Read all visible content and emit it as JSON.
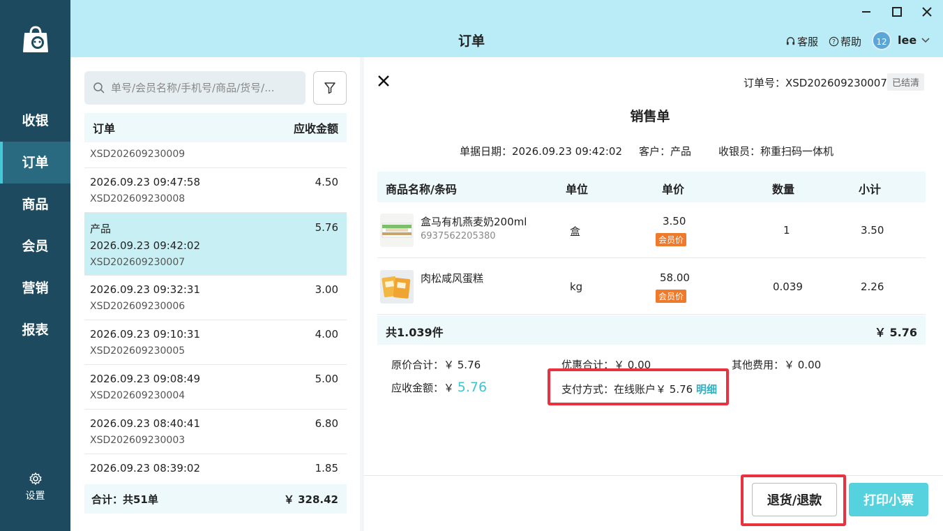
{
  "colors": {
    "nav_bg": "#1d4a5e",
    "nav_active": "#2a6a80",
    "topbar_bg": "#b9ecf6",
    "accent": "#56d2de",
    "member_tag": "#f07a2c",
    "highlight": "#e8333e"
  },
  "nav": {
    "items": [
      {
        "label": "收银",
        "icon": "cashier"
      },
      {
        "label": "订单",
        "icon": "orders",
        "active": true
      },
      {
        "label": "商品",
        "icon": "products"
      },
      {
        "label": "会员",
        "icon": "members"
      },
      {
        "label": "营销",
        "icon": "marketing"
      },
      {
        "label": "报表",
        "icon": "reports"
      }
    ],
    "settings_label": "设置"
  },
  "header": {
    "title": "订单",
    "support_label": "客服",
    "help_label": "帮助",
    "avatar_text": "12",
    "username": "lee"
  },
  "order_list": {
    "search_placeholder": "单号/会员名称/手机号/商品/货号/...",
    "col_order": "订单",
    "col_amount": "应收金额",
    "rows": [
      {
        "datetime": "",
        "order_no": "XSD202609230009",
        "amount": "",
        "partial": true
      },
      {
        "datetime": "2026.09.23 09:47:58",
        "order_no": "XSD202609230008",
        "amount": "4.50"
      },
      {
        "customer": "产品",
        "datetime": "2026.09.23 09:42:02",
        "order_no": "XSD202609230007",
        "amount": "5.76",
        "selected": true
      },
      {
        "datetime": "2026.09.23 09:32:31",
        "order_no": "XSD202609230006",
        "amount": "3.00"
      },
      {
        "datetime": "2026.09.23 09:10:31",
        "order_no": "XSD202609230005",
        "amount": "4.00"
      },
      {
        "datetime": "2026.09.23 09:08:49",
        "order_no": "XSD202609230004",
        "amount": "5.00"
      },
      {
        "datetime": "2026.09.23 08:40:41",
        "order_no": "XSD202609230003",
        "amount": "6.80"
      },
      {
        "datetime": "2026.09.23 08:39:02",
        "order_no": "",
        "amount": "1.85"
      }
    ],
    "footer_label": "合计：共51单",
    "footer_total": "￥ 328.42"
  },
  "detail": {
    "order_no_label": "订单号：XSD202609230007",
    "status": "已结清",
    "doc_title": "销售单",
    "date_label": "单据日期：2026.09.23 09:42:02",
    "customer_label": "客户：产品",
    "cashier_label": "收银员：称重扫码一体机",
    "columns": [
      "商品名称/条码",
      "单位",
      "单价",
      "数量",
      "小计"
    ],
    "products": [
      {
        "name": "盒马有机燕麦奶200ml",
        "barcode": "6937562205380",
        "unit": "盒",
        "price": "3.50",
        "tag": "会员价",
        "qty": "1",
        "subtotal": "3.50",
        "thumb": "oat-milk"
      },
      {
        "name": "肉松咸风蛋糕",
        "barcode": "",
        "unit": "kg",
        "price": "58.00",
        "tag": "会员价",
        "qty": "0.039",
        "subtotal": "2.26",
        "thumb": "cake"
      }
    ],
    "summary_count": "共1.039件",
    "summary_total": "￥ 5.76",
    "orig_total": "原价合计：￥ 5.76",
    "discount_total": "优惠合计：￥ 0.00",
    "other_fee": "其他费用：￥ 0.00",
    "due_label": "应收金额：￥",
    "due_amount": "5.76",
    "payment_label": "支付方式：在线账户￥ 5.76",
    "payment_detail_link": "明细",
    "refund_button": "退货/退款",
    "print_button": "打印小票"
  }
}
